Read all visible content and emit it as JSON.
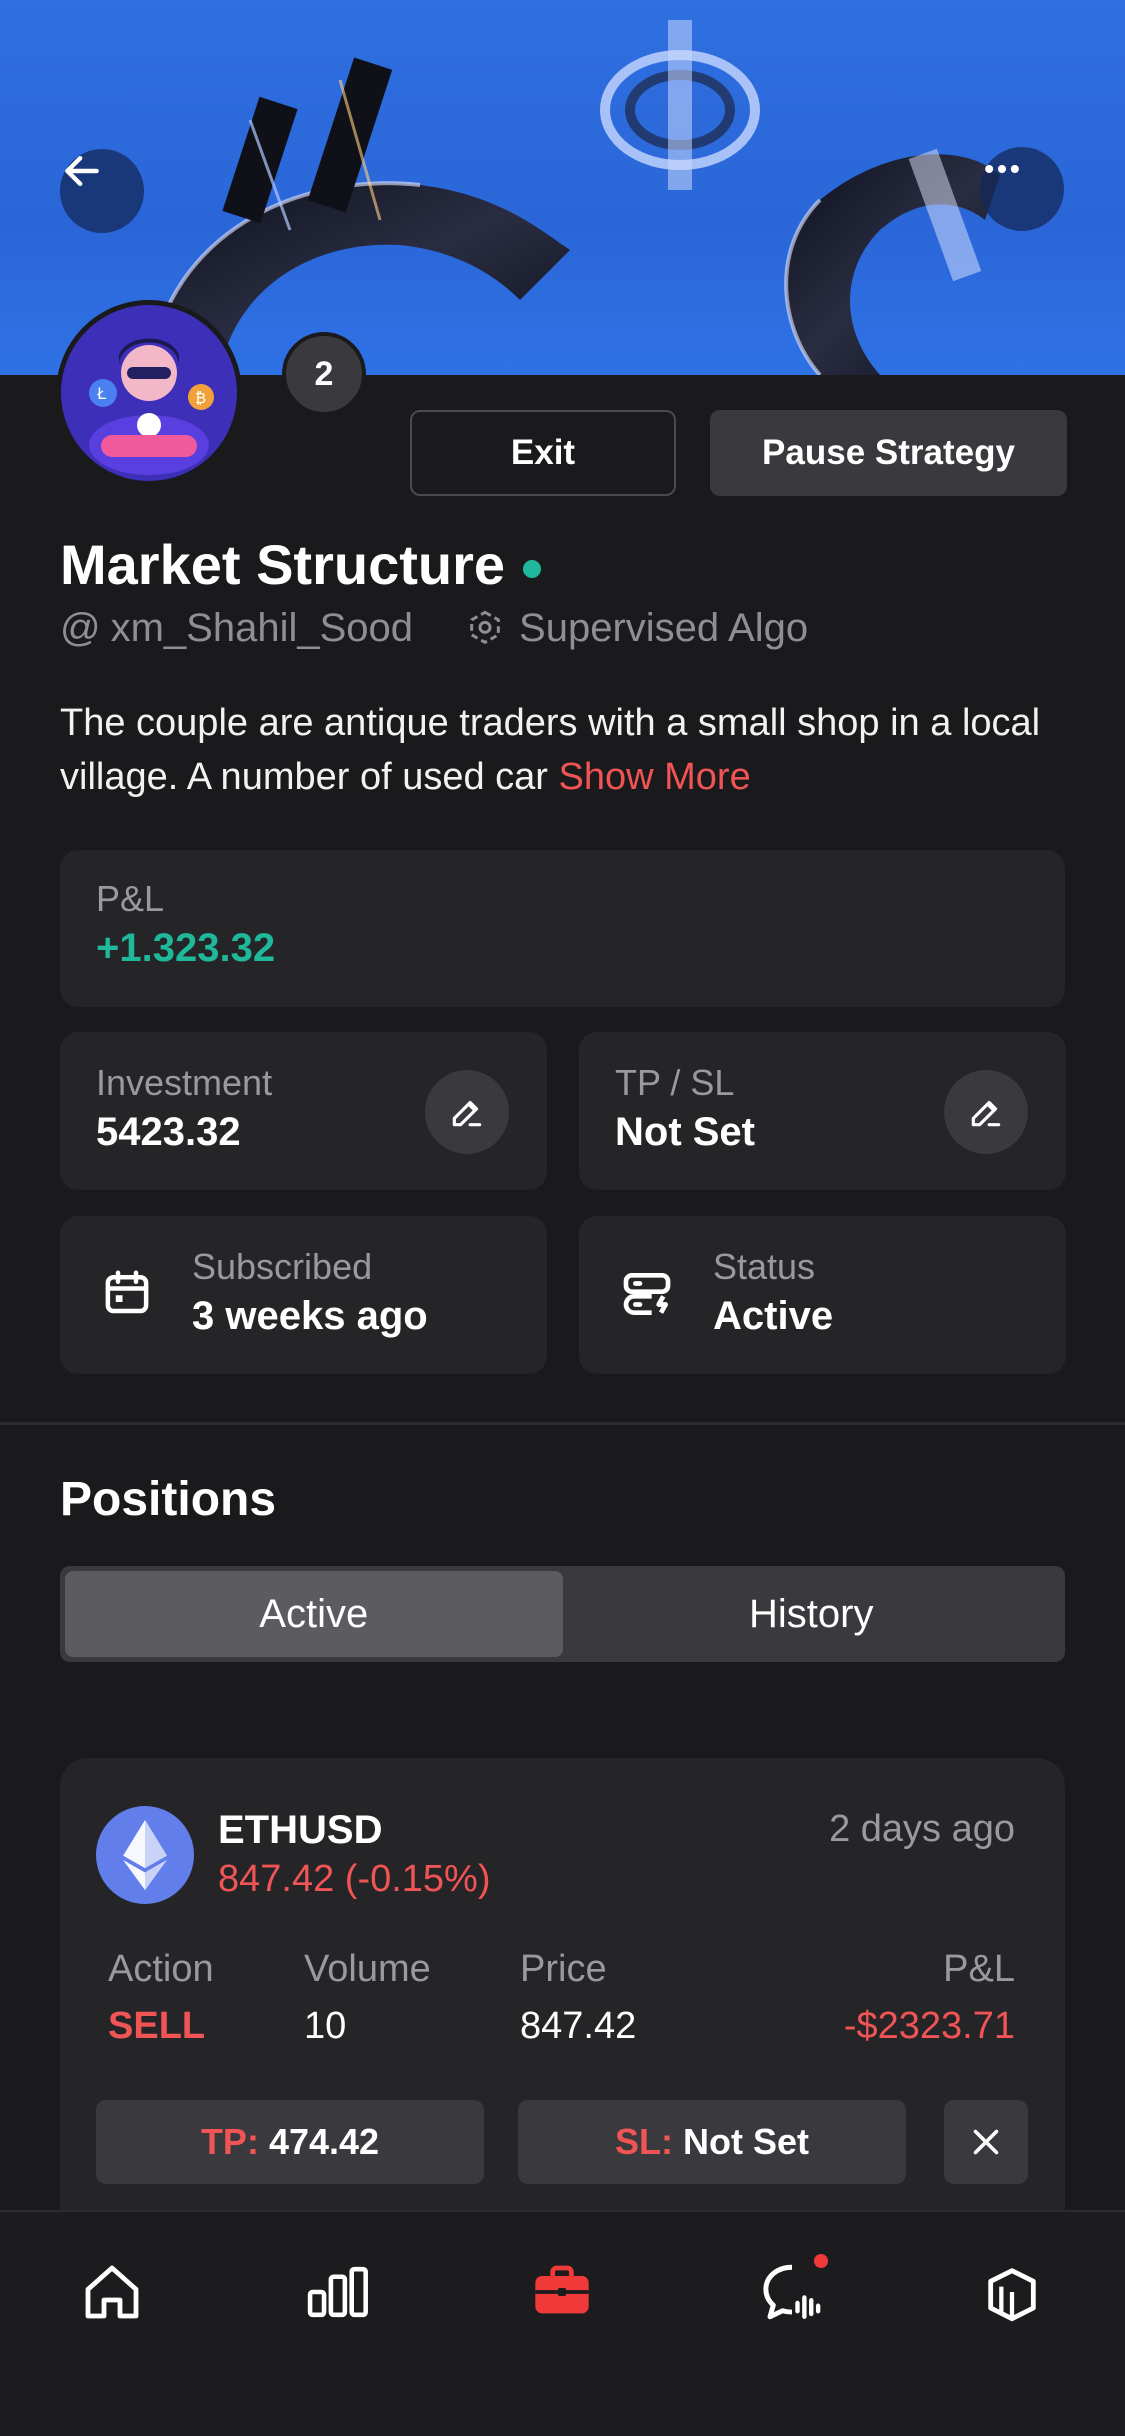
{
  "header": {
    "back_icon": "arrow-left-icon",
    "more_icon": "more-horizontal-icon",
    "banner_image": "crypto-currency-symbols-3d",
    "avatar_image": "hooded-gamer-with-crypto-coins",
    "subscriber_badge": "2",
    "exit_label": "Exit",
    "pause_label": "Pause Strategy"
  },
  "strategy": {
    "name": "Market Structure",
    "online_color": "#1fb89a",
    "author": "xm_Shahil_Sood",
    "type": "Supervised Algo",
    "description": "The couple are antique traders with a small shop in a local village. A number of used car",
    "show_more": "Show More"
  },
  "stats": {
    "pl_label": "P&L",
    "pl_value": "+1.323.32",
    "investment_label": "Investment",
    "investment_value": "5423.32",
    "tpsl_label": "TP / SL",
    "tpsl_value": "Not Set",
    "subscribed_label": "Subscribed",
    "subscribed_value": "3 weeks ago",
    "status_label": "Status",
    "status_value": "Active"
  },
  "positions": {
    "title": "Positions",
    "tabs": [
      {
        "label": "Active",
        "active": true
      },
      {
        "label": "History",
        "active": false
      }
    ],
    "items": [
      {
        "symbol": "ETHUSD",
        "price_change": "847.42 (-0.15%)",
        "time": "2 days ago",
        "action_label": "Action",
        "action_value": "SELL",
        "volume_label": "Volume",
        "volume_value": "10",
        "price_label": "Price",
        "price_value": "847.42",
        "pl_label": "P&L",
        "pl_value": "-$2323.71",
        "tp_key": "TP:",
        "tp_value": "474.42",
        "sl_key": "SL:",
        "sl_value": "Not Set"
      }
    ]
  },
  "nav": {
    "items": [
      {
        "icon": "home-icon"
      },
      {
        "icon": "bar-chart-icon"
      },
      {
        "icon": "briefcase-icon",
        "active": true
      },
      {
        "icon": "chat-icon",
        "notification": true
      },
      {
        "icon": "layers-icon"
      }
    ],
    "active_color": "#f03a3a"
  },
  "colors": {
    "positive": "#1fb89a",
    "negative": "#f05454",
    "background": "#1a1a1c",
    "card": "#252527"
  }
}
